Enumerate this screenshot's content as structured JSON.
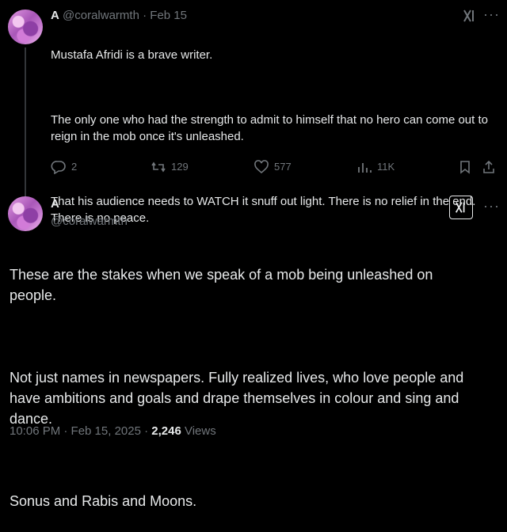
{
  "quoted_post": {
    "author_name": "A",
    "handle": "@coralwarmth",
    "separator": "·",
    "date": "Feb 15",
    "paragraphs": [
      "Mustafa Afridi is a brave writer.",
      "The only one who had the strength to admit to himself that no hero can come out to reign in the mob once it's unleashed.",
      "That his audience needs to WATCH it snuff out light. There is no relief in the end. There is no peace."
    ],
    "metrics": {
      "replies": "2",
      "reposts": "129",
      "likes": "577",
      "views": "11K"
    }
  },
  "main_post": {
    "author_name": "A",
    "handle": "@coralwarmth",
    "paragraphs": [
      "These are the stakes when we speak of a mob being unleashed on people.",
      "Not just names in newspapers. Fully realized lives, who love people and have ambitions and goals and drape themselves in colour and sing and dance.",
      "Sonus and Rabis and Moons."
    ],
    "timestamp": "10:06 PM · Feb 15, 2025 · ",
    "views_count": "2,246",
    "views_label": " Views"
  },
  "icons": {
    "more": "more-icon",
    "grok": "grok-icon",
    "reply": "reply-icon",
    "repost": "repost-icon",
    "like": "like-icon",
    "views": "views-icon",
    "bookmark": "bookmark-icon",
    "share": "share-icon"
  },
  "colors": {
    "background": "#000000",
    "text": "#e7e9ea",
    "muted": "#71767b"
  }
}
